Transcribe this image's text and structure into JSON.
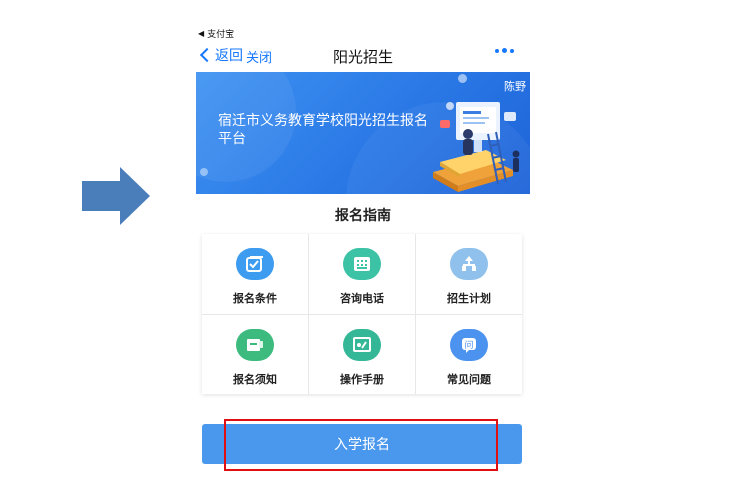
{
  "status_bar": {
    "app_name": "支付宝"
  },
  "nav": {
    "back_label": "返回",
    "close_label": "关闭",
    "title": "阳光招生"
  },
  "banner": {
    "title": "宿迁市义务教育学校阳光招生报名平台",
    "corner_tag": "陈野"
  },
  "guide": {
    "title": "报名指南",
    "items": [
      {
        "label": "报名条件",
        "icon": "checkbox-icon",
        "color": "#3d9bf0"
      },
      {
        "label": "咨询电话",
        "icon": "phone-keypad-icon",
        "color": "#3cc3a6"
      },
      {
        "label": "招生计划",
        "icon": "org-chart-icon",
        "color": "#8fc1ec"
      },
      {
        "label": "报名须知",
        "icon": "notice-board-icon",
        "color": "#3dbb7e"
      },
      {
        "label": "操作手册",
        "icon": "manual-screen-icon",
        "color": "#34b796"
      },
      {
        "label": "常见问题",
        "icon": "question-bubble-icon",
        "color": "#4b93ee"
      }
    ]
  },
  "enroll": {
    "label": "入学报名"
  },
  "colors": {
    "accent": "#1677ff",
    "highlight": "#e01010",
    "button": "#4a97ee"
  }
}
